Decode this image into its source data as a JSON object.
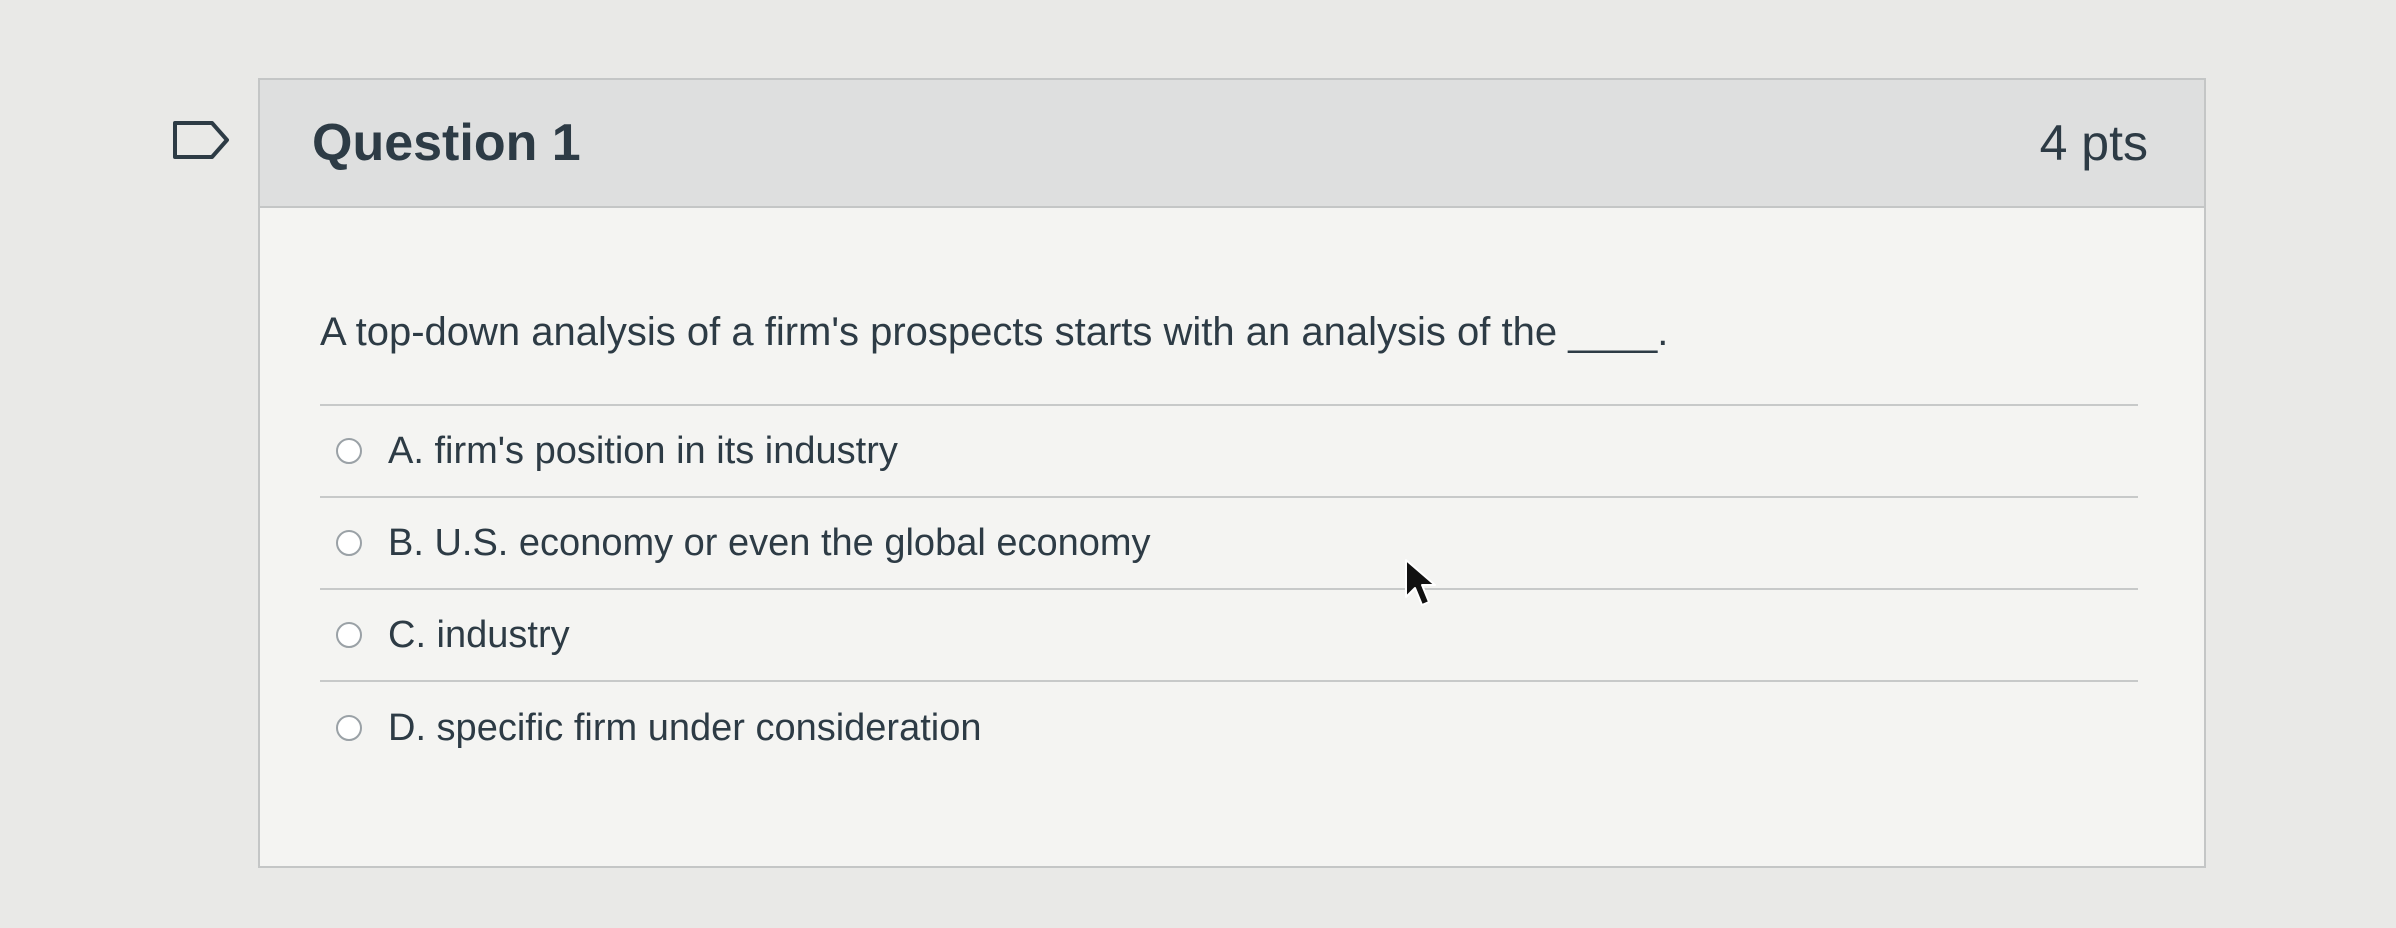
{
  "question": {
    "title": "Question 1",
    "points": "4 pts",
    "text": "A top-down analysis of a firm's prospects starts with an analysis of the ____."
  },
  "answers": [
    {
      "label": "A. firm's position in its industry"
    },
    {
      "label": "B. U.S. economy or even the global economy"
    },
    {
      "label": "C. industry"
    },
    {
      "label": "D. specific firm under consideration"
    }
  ],
  "icons": {
    "flag": "flag-question-icon",
    "cursor": "mouse-pointer-icon"
  },
  "colors": {
    "text": "#2d3b45",
    "header_bg": "#dedfdf",
    "border": "#c4c6c6"
  }
}
